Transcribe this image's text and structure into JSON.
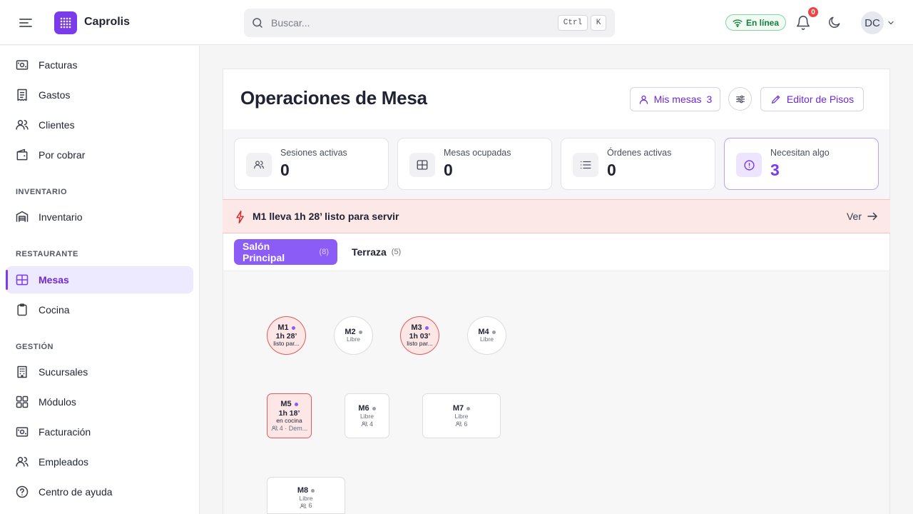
{
  "app": {
    "name": "Caprolis",
    "menu_icon": "menu-icon",
    "logo_icon": "grid-dots-icon"
  },
  "search": {
    "placeholder": "Buscar...",
    "shortcut_key1": "Ctrl",
    "shortcut_key2": "K"
  },
  "header": {
    "status_label": "En línea",
    "notifications_count": "0",
    "avatar_initials": "DC"
  },
  "colors": {
    "accent": "#7c3aed",
    "online": "#15803d",
    "alert": "#dc2626"
  },
  "sidebar": {
    "items_top": [
      {
        "label": "Facturas",
        "icon": "receipt-icon"
      },
      {
        "label": "Gastos",
        "icon": "receipt-list-icon"
      },
      {
        "label": "Clientes",
        "icon": "users-icon"
      },
      {
        "label": "Por cobrar",
        "icon": "wallet-icon"
      }
    ],
    "section_inventario": "INVENTARIO",
    "inventario_items": [
      {
        "label": "Inventario",
        "icon": "warehouse-icon"
      }
    ],
    "section_restaurante": "RESTAURANTE",
    "restaurante_items": [
      {
        "label": "Mesas",
        "icon": "table-grid-icon",
        "active": true
      },
      {
        "label": "Cocina",
        "icon": "clipboard-icon"
      }
    ],
    "section_gestion": "GESTIÓN",
    "gestion_items": [
      {
        "label": "Sucursales",
        "icon": "building-icon"
      },
      {
        "label": "Módulos",
        "icon": "modules-icon"
      },
      {
        "label": "Facturación",
        "icon": "billing-icon"
      },
      {
        "label": "Empleados",
        "icon": "users-icon"
      },
      {
        "label": "Centro de ayuda",
        "icon": "help-circle-icon"
      }
    ]
  },
  "main": {
    "title": "Operaciones de Mesa",
    "my_tables_label": "Mis mesas",
    "my_tables_count": "3",
    "floor_editor_label": "Editor de Pisos",
    "stats": [
      {
        "label": "Sesiones activas",
        "value": "0",
        "icon": "users-icon"
      },
      {
        "label": "Mesas ocupadas",
        "value": "0",
        "icon": "table-grid-icon"
      },
      {
        "label": "Órdenes activas",
        "value": "0",
        "icon": "list-icon"
      },
      {
        "label": "Necesitan algo",
        "value": "3",
        "icon": "alert-circle-icon"
      }
    ],
    "banner": {
      "text": "M1 lleva 1h 28’ listo para servir",
      "action": "Ver"
    },
    "tabs": [
      {
        "label": "Salón Principal",
        "count": "(8)",
        "active": true
      },
      {
        "label": "Terraza",
        "count": "(5)",
        "active": false
      }
    ],
    "tables": [
      {
        "name": "M1",
        "time": "1h 28’",
        "status": "listo par...",
        "busy": true
      },
      {
        "name": "M2",
        "status": "Libre",
        "busy": false
      },
      {
        "name": "M3",
        "time": "1h 03’",
        "status": "listo par...",
        "busy": true
      },
      {
        "name": "M4",
        "status": "Libre",
        "busy": false
      },
      {
        "name": "M5",
        "time": "1h 18’",
        "status": "en cocina",
        "capacity": "4 · Dem...",
        "busy": true
      },
      {
        "name": "M6",
        "status": "Libre",
        "capacity": "4",
        "busy": false
      },
      {
        "name": "M7",
        "status": "Libre",
        "capacity": "6",
        "busy": false
      },
      {
        "name": "M8",
        "status": "Libre",
        "capacity": "6",
        "busy": false
      }
    ]
  }
}
